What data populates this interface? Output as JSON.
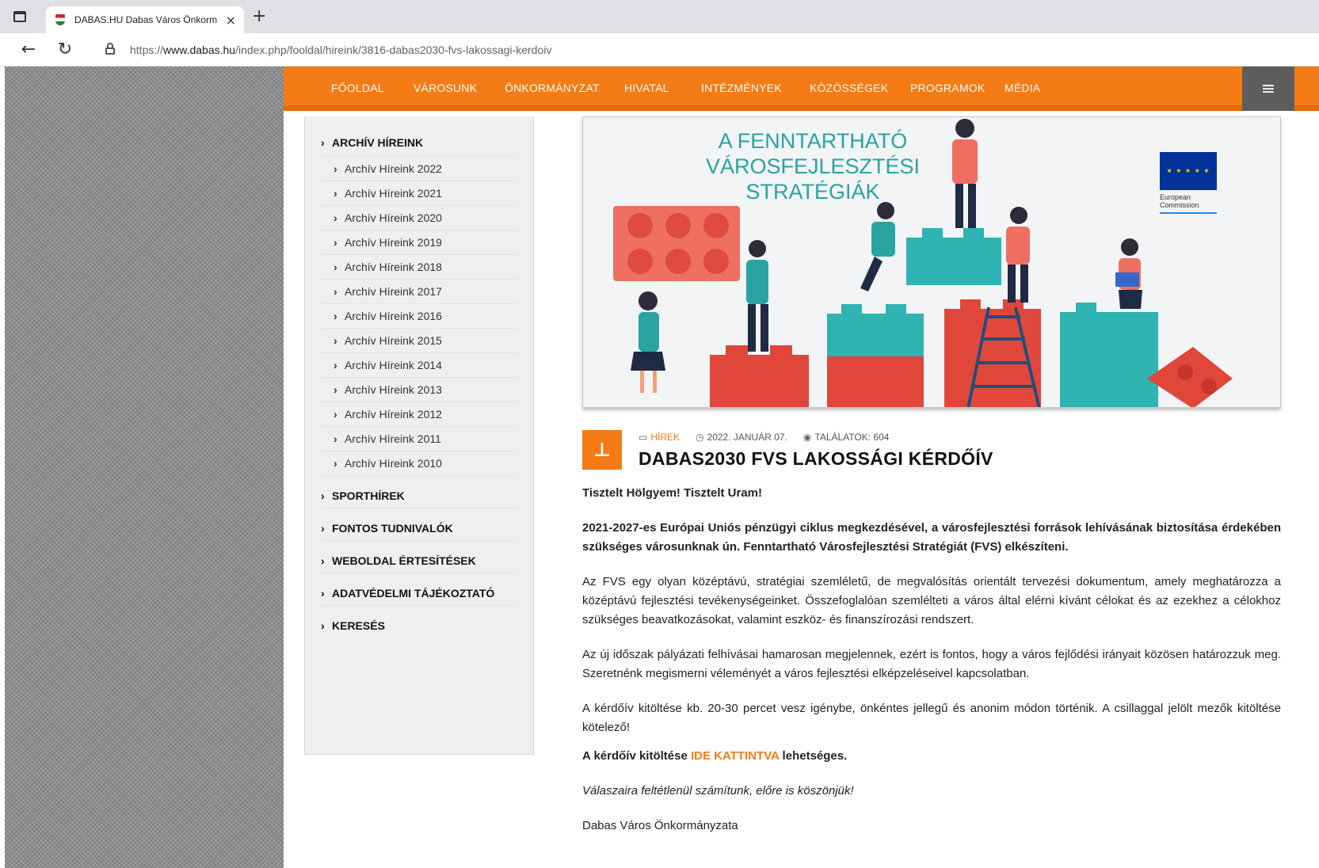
{
  "browser": {
    "tab_title": "DABAS.HU Dabas Város Önkorm",
    "close_glyph": "×",
    "newtab_glyph": "+",
    "url_prefix": "https://",
    "url_domain": "www.dabas.hu",
    "url_path": "/index.php/fooldal/hireink/3816-dabas2030-fvs-lakossagi-kerdoiv"
  },
  "nav": {
    "items": [
      "FŐOLDAL",
      "VÁROSUNK",
      "ÖNKORMÁNYZAT",
      "HIVATAL",
      "INTÉZMÉNYEK",
      "KÖZÖSSÉGEK",
      "PROGRAMOK",
      "MÉDIA"
    ],
    "menu_icon": "hamburger-icon"
  },
  "sidebar": {
    "archive_title": "ARCHÍV HÍREINK",
    "archive_items": [
      "Archív Híreink 2022",
      "Archív Híreink 2021",
      "Archív Híreink 2020",
      "Archív Híreink 2019",
      "Archív Híreink 2018",
      "Archív Híreink 2017",
      "Archív Híreink 2016",
      "Archív Híreink 2015",
      "Archív Híreink 2014",
      "Archív Híreink 2013",
      "Archív Híreink 2012",
      "Archív Híreink 2011",
      "Archív Híreink 2010"
    ],
    "categories": [
      "SPORTHÍREK",
      "FONTOS TUDNIVALÓK",
      "WEBOLDAL ÉRTESÍTÉSEK",
      "ADATVÉDELMI TÁJÉKOZTATÓ",
      "KERESÉS"
    ]
  },
  "banner": {
    "title_lines": [
      "A FENNTARTHATÓ",
      "VÁROSFEJLESZTÉSI",
      "STRATÉGIÁK"
    ],
    "logo_text": [
      "European",
      "Commission"
    ]
  },
  "article": {
    "category": "HÍREK",
    "date": "2022. JANUÁR 07.",
    "hits": "TALÁLATOK: 604",
    "title": "DABAS2030 FVS LAKOSSÁGI KÉRDŐÍV",
    "greeting": "Tisztelt Hölgyem! Tisztelt Uram!",
    "lead": "2021-2027-es Európai Uniós pénzügyi ciklus megkezdésével, a városfejlesztési források lehívásának biztosítása érdekében szükséges városunknak ún. Fenntartható Városfejlesztési Stratégiát (FVS) elkészíteni.",
    "p1": "Az FVS egy olyan középtávú, stratégiai szemléletű, de megvalósítás orientált tervezési dokumentum, amely meghatározza a középtávú fejlesztési tevékenységeinket. Összefoglalóan szemlélteti a város által elérni kívánt célokat és az ezekhez a célokhoz szükséges beavatkozásokat, valamint eszköz- és finanszírozási rendszert.",
    "p2": "Az új időszak pályázati felhívásai hamarosan megjelennek, ezért is fontos, hogy a város fejlődési irányait közösen határozzuk meg. Szeretnénk megismerni véleményét a város fejlesztési elképzeléseivel kapcsolatban.",
    "p3": "A kérdőív kitöltése kb. 20-30 percet vesz igénybe, önkéntes jellegű és anonim módon történik. A csillaggal jelölt mezők kitöltése kötelező!",
    "cta_before": "A kérdőív kitöltése ",
    "cta_link": "IDE KATTINTVA",
    "cta_after": " lehetséges.",
    "thanks": "Válaszaira feltétlenül számítunk, előre is köszönjük!",
    "signature": "Dabas Város Önkormányzata"
  },
  "colors": {
    "accent": "#f47b16",
    "teal": "#2aa3a3",
    "eu_blue": "#003399"
  }
}
